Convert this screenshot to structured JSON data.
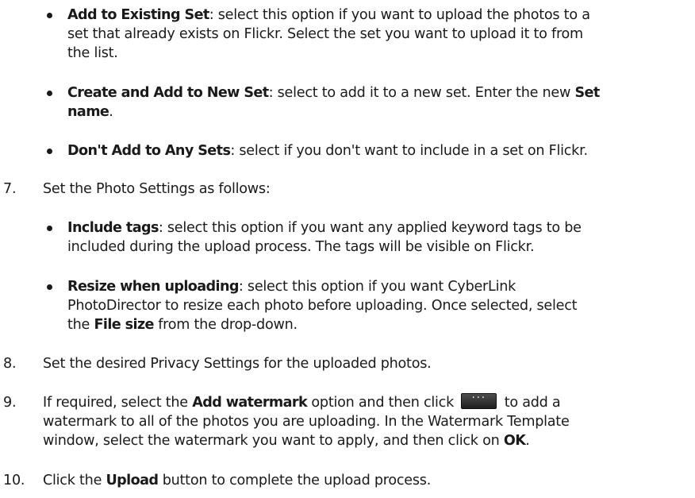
{
  "bullets_a": [
    {
      "term": "Add to Existing Set",
      "line1": ": select this option if you want to upload the photos to a",
      "line2": "set that already exists on Flickr. Select the set you want to upload it to from",
      "line3": "the list."
    },
    {
      "term": "Create and Add to New Set",
      "text1": ": select to add it to a new set. Enter the new ",
      "term2": "Set",
      "term2b": "name",
      "text2": "."
    },
    {
      "term": "Don't Add to Any Sets",
      "text1": ": select if you don't want to include in a set on Flickr."
    }
  ],
  "step7": {
    "number": "7.",
    "text": "Set the Photo Settings as follows:"
  },
  "bullets_b": [
    {
      "term": "Include tags",
      "line1": ": select this option if you want any applied keyword tags to be",
      "line2": "included during the upload process. The tags will be visible on Flickr."
    },
    {
      "term": "Resize when uploading",
      "line1": ": select this option if you want CyberLink",
      "line2": "PhotoDirector to resize each photo before uploading. Once selected, select",
      "line3a": "the ",
      "term2": "File size",
      "line3b": " from the drop-down."
    }
  ],
  "step8": {
    "number": "8.",
    "text": "Set the desired Privacy Settings for the uploaded photos."
  },
  "step9": {
    "number": "9.",
    "pre": "If required, select the ",
    "term": "Add watermark",
    "mid": " option and then click ",
    "button_label": "···",
    "post": " to add a",
    "line2": "watermark to all of the photos you are uploading. In the Watermark Template",
    "line3a": "window, select the watermark you want to apply, and then click on ",
    "term2": "OK",
    "line3b": "."
  },
  "step10": {
    "number": "10.",
    "pre": "Click the ",
    "term": "Upload",
    "post": " button to complete the upload process."
  }
}
